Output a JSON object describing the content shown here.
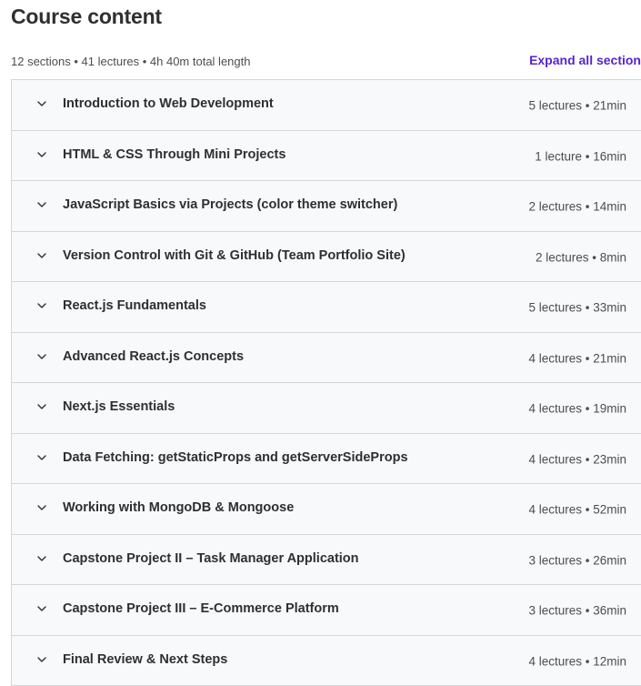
{
  "header": {
    "title": "Course content",
    "summary": "12 sections • 41 lectures • 4h 40m total length",
    "expand_all_label": "Expand all section"
  },
  "colors": {
    "accent": "#5624d0",
    "row_background": "#f7f9fa",
    "border": "#d1d7dc"
  },
  "sections": [
    {
      "title": "Introduction to Web Development",
      "meta": "5 lectures • 21min",
      "icon": "chevron-down-icon"
    },
    {
      "title": "HTML & CSS Through Mini Projects",
      "meta": "1 lecture • 16min",
      "icon": "chevron-down-icon"
    },
    {
      "title": "JavaScript Basics via Projects (color theme switcher)",
      "meta": "2 lectures • 14min",
      "icon": "chevron-down-icon"
    },
    {
      "title": "Version Control with Git & GitHub (Team Portfolio Site)",
      "meta": "2 lectures • 8min",
      "icon": "chevron-down-icon"
    },
    {
      "title": "React.js Fundamentals",
      "meta": "5 lectures • 33min",
      "icon": "chevron-down-icon"
    },
    {
      "title": "Advanced React.js Concepts",
      "meta": "4 lectures • 21min",
      "icon": "chevron-down-icon"
    },
    {
      "title": "Next.js Essentials",
      "meta": "4 lectures • 19min",
      "icon": "chevron-down-icon"
    },
    {
      "title": "Data Fetching: getStaticProps and getServerSideProps",
      "meta": "4 lectures • 23min",
      "icon": "chevron-down-icon"
    },
    {
      "title": "Working with MongoDB & Mongoose",
      "meta": "4 lectures • 52min",
      "icon": "chevron-down-icon"
    },
    {
      "title": "Capstone Project II – Task Manager Application",
      "meta": "3 lectures • 26min",
      "icon": "chevron-down-icon"
    },
    {
      "title": "Capstone Project III – E-Commerce Platform",
      "meta": "3 lectures • 36min",
      "icon": "chevron-down-icon"
    },
    {
      "title": "Final Review & Next Steps",
      "meta": "4 lectures • 12min",
      "icon": "chevron-down-icon"
    }
  ]
}
